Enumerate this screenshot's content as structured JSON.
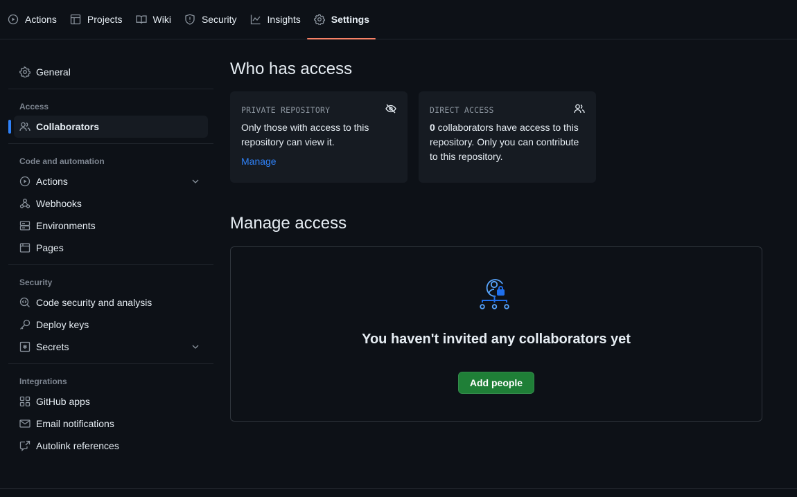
{
  "repo_tabs": [
    {
      "label": "Actions",
      "icon": "play-icon",
      "active": false
    },
    {
      "label": "Projects",
      "icon": "table-icon",
      "active": false
    },
    {
      "label": "Wiki",
      "icon": "book-icon",
      "active": false
    },
    {
      "label": "Security",
      "icon": "shield-icon",
      "active": false
    },
    {
      "label": "Insights",
      "icon": "graph-icon",
      "active": false
    },
    {
      "label": "Settings",
      "icon": "gear-icon",
      "active": true
    }
  ],
  "sidebar": {
    "general": "General",
    "sections": [
      {
        "heading": "Access",
        "items": [
          {
            "label": "Collaborators",
            "active": true
          }
        ]
      },
      {
        "heading": "Code and automation",
        "items": [
          {
            "label": "Actions",
            "expandable": true
          },
          {
            "label": "Webhooks"
          },
          {
            "label": "Environments"
          },
          {
            "label": "Pages"
          }
        ]
      },
      {
        "heading": "Security",
        "items": [
          {
            "label": "Code security and analysis"
          },
          {
            "label": "Deploy keys"
          },
          {
            "label": "Secrets",
            "expandable": true
          }
        ]
      },
      {
        "heading": "Integrations",
        "items": [
          {
            "label": "GitHub apps"
          },
          {
            "label": "Email notifications"
          },
          {
            "label": "Autolink references"
          }
        ]
      }
    ]
  },
  "who_has_access": {
    "title": "Who has access",
    "private_card": {
      "title": "PRIVATE REPOSITORY",
      "text": "Only those with access to this repository can view it.",
      "link": "Manage"
    },
    "direct_card": {
      "title": "DIRECT ACCESS",
      "count": "0",
      "text": " collaborators have access to this repository. Only you can contribute to this repository."
    }
  },
  "manage_access": {
    "title": "Manage access",
    "empty_title": "You haven't invited any collaborators yet",
    "add_button": "Add people"
  },
  "colors": {
    "background": "#0d1117",
    "accent_blue": "#2f81f7",
    "active_tab_underline": "#f78166",
    "primary_button": "#238636"
  }
}
